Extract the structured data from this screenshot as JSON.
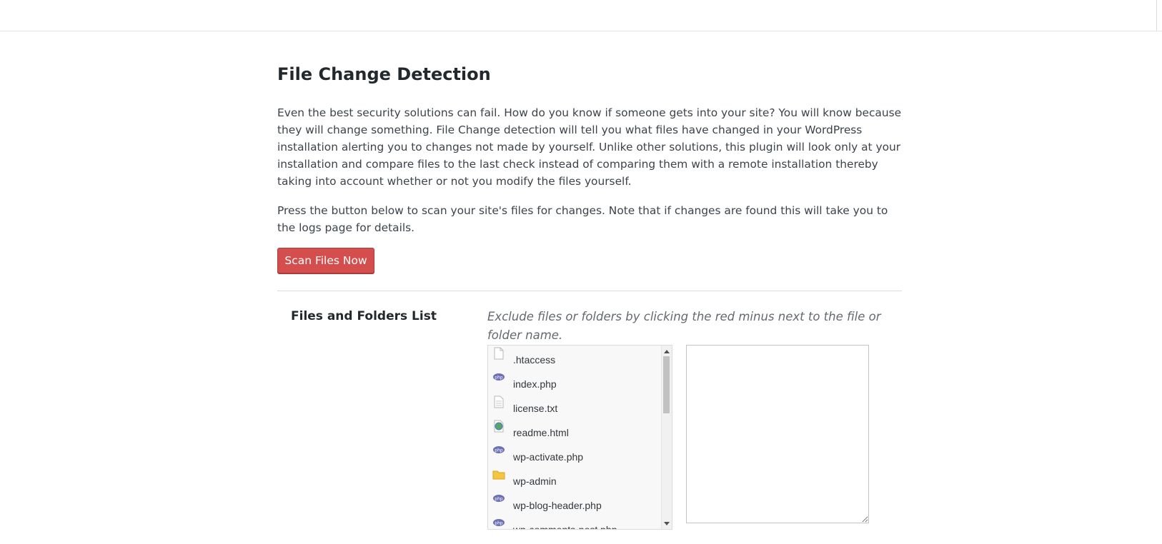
{
  "page": {
    "title": "File Change Detection",
    "description": "Even the best security solutions can fail. How do you know if someone gets into your site? You will know because they will change something. File Change detection will tell you what files have changed in your WordPress installation alerting you to changes not made by yourself. Unlike other solutions, this plugin will look only at your installation and compare files to the last check instead of comparing them with a remote installation thereby taking into account whether or not you modify the files yourself.",
    "scan_instructions": "Press the button below to scan your site's files for changes. Note that if changes are found this will take you to the logs page for details.",
    "scan_button_label": "Scan Files Now"
  },
  "files_section": {
    "label": "Files and Folders List",
    "hint": "Exclude files or folders by clicking the red minus next to the file or folder name.",
    "items": [
      {
        "name": ".htaccess",
        "icon": "file-icon"
      },
      {
        "name": "index.php",
        "icon": "php-file-icon"
      },
      {
        "name": "license.txt",
        "icon": "text-file-icon"
      },
      {
        "name": "readme.html",
        "icon": "html-file-icon"
      },
      {
        "name": "wp-activate.php",
        "icon": "php-file-icon"
      },
      {
        "name": "wp-admin",
        "icon": "folder-icon"
      },
      {
        "name": "wp-blog-header.php",
        "icon": "php-file-icon"
      },
      {
        "name": "wp-comments-post.php",
        "icon": "php-file-icon"
      }
    ],
    "exclude_value": ""
  },
  "colors": {
    "scan_button": "#d54e4e",
    "php_icon": "#6c6fb3",
    "folder_icon": "#f5c542"
  }
}
